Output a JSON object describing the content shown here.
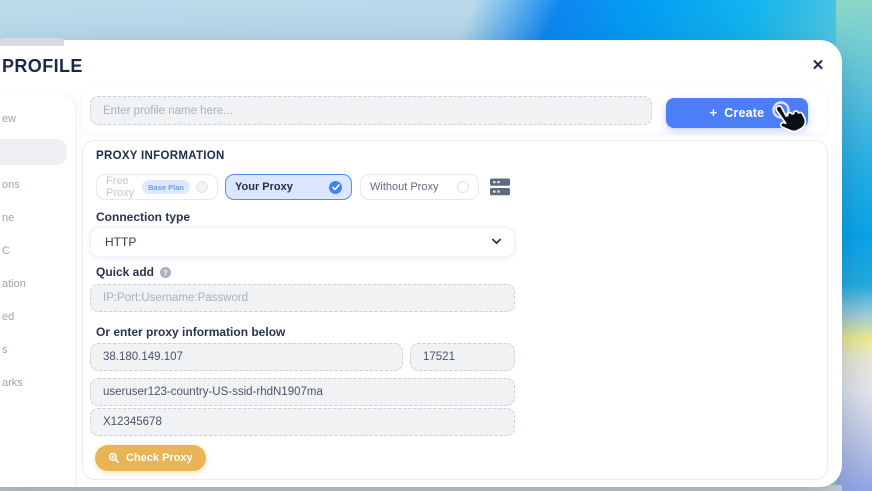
{
  "window": {
    "title": "PROFILE",
    "close_icon": "✕"
  },
  "sidebar": {
    "items": [
      {
        "label": "ew",
        "selected": false
      },
      {
        "label": "",
        "selected": true
      },
      {
        "label": "ons",
        "selected": false
      },
      {
        "label": "ne",
        "selected": false
      },
      {
        "label": "C",
        "selected": false
      },
      {
        "label": "ation",
        "selected": false
      },
      {
        "label": "ed",
        "selected": false
      },
      {
        "label": "s",
        "selected": false
      },
      {
        "label": "arks",
        "selected": false
      }
    ]
  },
  "profile_bar": {
    "name_placeholder": "Enter profile name here...",
    "create_icon": "+",
    "create_label": "Create"
  },
  "proxy": {
    "section_title": "PROXY INFORMATION",
    "options": {
      "free": {
        "label": "Free Proxy",
        "badge": "Base Plan",
        "state": "disabled"
      },
      "your": {
        "label": "Your Proxy",
        "state": "selected"
      },
      "without": {
        "label": "Without Proxy",
        "state": "default"
      }
    },
    "connection_type_label": "Connection type",
    "connection_type_value": "HTTP",
    "quick_add_label": "Quick add",
    "quick_add_help": "?",
    "quick_add_placeholder": "IP:Port:Username:Password",
    "manual_label": "Or enter proxy information below",
    "ip": "38.180.149.107",
    "port": "17521",
    "username": "useruser123-country-US-ssid-rhdN1907ma",
    "password": "X12345678",
    "check_button_label": "Check Proxy"
  },
  "colors": {
    "accent": "#4c7ef8",
    "selected_option_bg": "#dbe7fd",
    "selected_option_border": "#568af7",
    "check_button": "#e9b454",
    "title_text": "#1b2945"
  }
}
